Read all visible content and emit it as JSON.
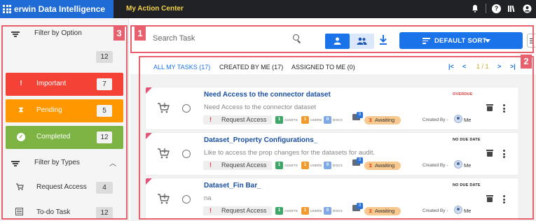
{
  "app": {
    "brand": "erwin Data Intelligence",
    "section": "My Action Center",
    "icons": [
      "bell-icon",
      "help-icon",
      "library-icon",
      "account-icon"
    ]
  },
  "sidebar": {
    "filter_by_option": "Filter by Option",
    "all_count": "12",
    "options": [
      {
        "label": "Important",
        "count": "7",
        "color": "#f44336",
        "icon": "!"
      },
      {
        "label": "Pending",
        "count": "5",
        "color": "#ff9800",
        "icon": "⧗"
      },
      {
        "label": "Completed",
        "count": "12",
        "color": "#7cb342",
        "icon": "✓"
      }
    ],
    "filter_by_types": "Filter by Types",
    "types": [
      {
        "label": "Request Access",
        "count": "4",
        "icon": "cart-icon"
      },
      {
        "label": "To-do Task",
        "count": "12",
        "icon": "todo-icon"
      }
    ]
  },
  "search": {
    "placeholder": "Search Task",
    "sort_label": "DEFAULT SORT"
  },
  "tabs": [
    {
      "label": "ALL MY TASKS (17)",
      "active": true
    },
    {
      "label": "CREATED BY ME (17)",
      "active": false
    },
    {
      "label": "ASSIGNED TO ME (0)",
      "active": false
    }
  ],
  "pager": {
    "page": "1 / 1"
  },
  "tasks": [
    {
      "title": "Need Access to the connector dataset",
      "description": "Need Access to the connector dataset",
      "due": "OVERDUE",
      "overdue": true,
      "type": "Request Access",
      "assets_count": "1",
      "users_count": "1",
      "docs_count": "0",
      "comments": "0",
      "status": "Awaiting",
      "created_by_label": "Created By -",
      "creator": "Me"
    },
    {
      "title": "Dataset_Property Configurations_",
      "description": "Like to access the prop changes for the datasets for audit.",
      "due": "NO DUE DATE",
      "overdue": false,
      "type": "Request Access",
      "assets_count": "1",
      "users_count": "1",
      "docs_count": "0",
      "comments": "0",
      "status": "Awaiting",
      "created_by_label": "Created By -",
      "creator": "Me"
    },
    {
      "title": "Dataset_Fin Bar_",
      "description": "na",
      "due": "NO DUE DATE",
      "overdue": false,
      "type": "Request Access",
      "assets_count": "1",
      "users_count": "1",
      "docs_count": "0",
      "comments": "0",
      "status": "Awaiting",
      "created_by_label": "Created By -",
      "creator": "Me"
    }
  ],
  "meta_labels": {
    "assets": "ASSETS",
    "users": "USERS",
    "docs": "DOCS"
  },
  "annotations": [
    "1",
    "2",
    "3"
  ],
  "colors": {
    "accent": "#1a73e8",
    "annotation": "#e8606e",
    "brand": "#1e6bd6"
  }
}
